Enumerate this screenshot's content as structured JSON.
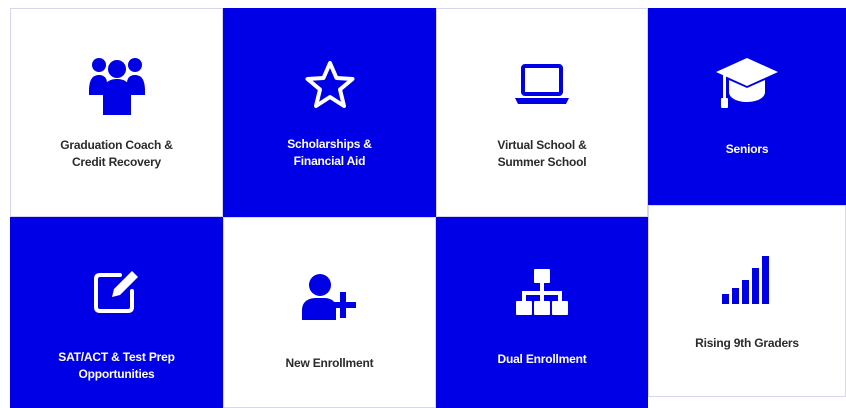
{
  "colors": {
    "accent_blue": "#0000e6",
    "tile_white": "#ffffff",
    "text_dark": "#2b2b2b",
    "text_light": "#ffffff"
  },
  "tiles": [
    {
      "lines": [
        "Graduation Coach &",
        "Credit Recovery"
      ],
      "icon": "people-group-icon",
      "style": "white"
    },
    {
      "lines": [
        "Scholarships &",
        "Financial Aid"
      ],
      "icon": "star-icon",
      "style": "blue"
    },
    {
      "lines": [
        "Virtual School &",
        "Summer School"
      ],
      "icon": "laptop-icon",
      "style": "white"
    },
    {
      "lines": [
        "Seniors"
      ],
      "icon": "graduation-cap-icon",
      "style": "blue"
    },
    {
      "lines": [
        "SAT/ACT & Test Prep",
        "Opportunities"
      ],
      "icon": "edit-icon",
      "style": "blue"
    },
    {
      "lines": [
        "New Enrollment"
      ],
      "icon": "add-user-icon",
      "style": "white"
    },
    {
      "lines": [
        "Dual Enrollment"
      ],
      "icon": "sitemap-icon",
      "style": "blue"
    },
    {
      "lines": [
        "Rising 9th Graders"
      ],
      "icon": "signal-bars-icon",
      "style": "white"
    }
  ]
}
